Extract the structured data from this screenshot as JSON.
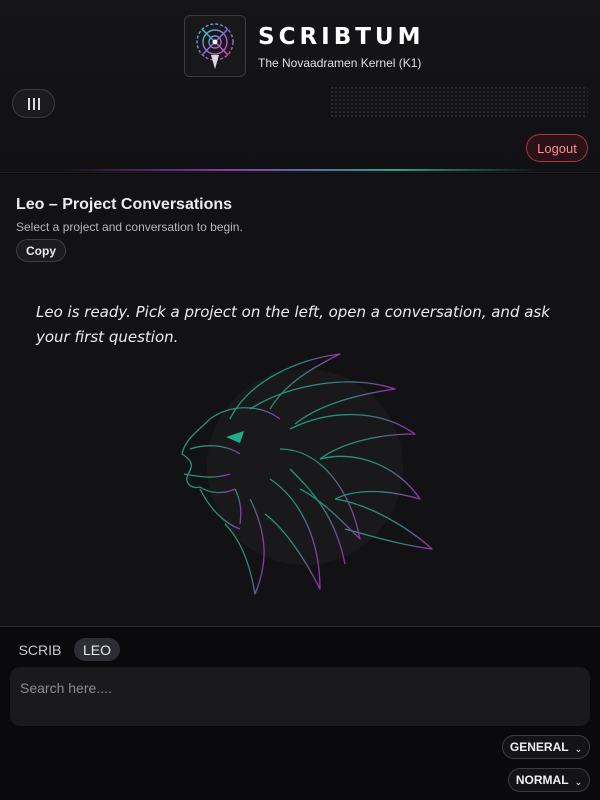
{
  "header": {
    "brand_title": "SCRIBTUM",
    "brand_subtitle": "The Novaadramen Kernel (K1)",
    "logout_label": "Logout",
    "menu_icon": "menu-icon"
  },
  "conversation": {
    "title": "Leo – Project Conversations",
    "subtitle": "Select a project and conversation to begin.",
    "copy_label": "Copy",
    "ready_message": "Leo is ready. Pick a project on the left, open a conversation, and ask your first question."
  },
  "bottom": {
    "tabs": [
      {
        "label": "SCRIB",
        "active": false
      },
      {
        "label": "LEO",
        "active": true
      }
    ],
    "search_placeholder": "Search here....",
    "scope_select": "GENERAL",
    "mode_select": "NORMAL"
  },
  "colors": {
    "accent_purple": "#8a3bb0",
    "accent_teal": "#2aa58a",
    "logout_red": "#a83246",
    "background": "#0b0b0d"
  }
}
